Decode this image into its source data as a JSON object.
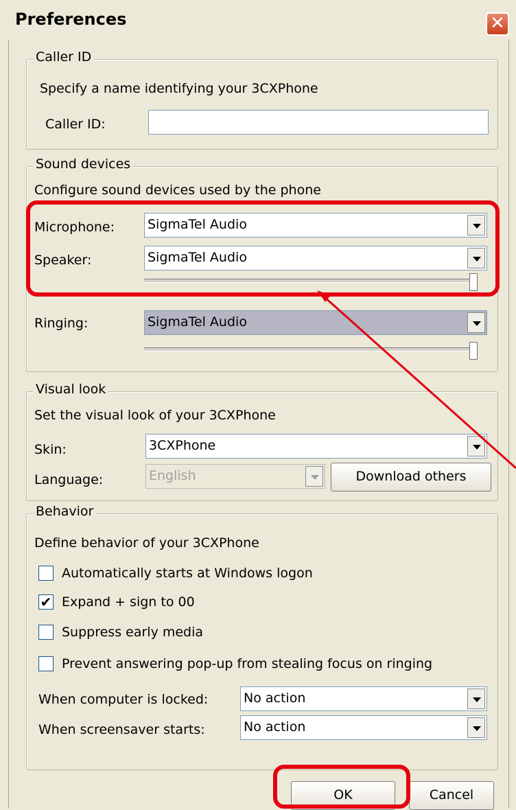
{
  "window": {
    "title": "Preferences",
    "close_symbol": "✕"
  },
  "caller_id": {
    "legend": "Caller ID",
    "description": "Specify a name identifying your 3CXPhone",
    "label": "Caller ID:",
    "value": ""
  },
  "sound": {
    "legend": "Sound devices",
    "description": "Configure sound devices used by the phone",
    "microphone_label": "Microphone:",
    "microphone_value": "SigmaTel Audio",
    "speaker_label": "Speaker:",
    "speaker_value": "SigmaTel Audio",
    "speaker_volume": 1.0,
    "ringing_label": "Ringing:",
    "ringing_value": "SigmaTel Audio",
    "ringing_volume": 1.0
  },
  "visual": {
    "legend": "Visual look",
    "description": "Set the visual look of your 3CXPhone",
    "skin_label": "Skin:",
    "skin_value": "3CXPhone",
    "language_label": "Language:",
    "language_value": "English",
    "download_label": "Download others"
  },
  "behavior": {
    "legend": "Behavior",
    "description": "Define behavior of your 3CXPhone",
    "options": [
      {
        "label": "Automatically starts at Windows logon",
        "checked": false
      },
      {
        "label": "Expand + sign to 00",
        "checked": true
      },
      {
        "label": "Suppress early media",
        "checked": false
      },
      {
        "label": "Prevent answering pop-up from stealing focus on ringing",
        "checked": false
      }
    ],
    "locked_label": "When computer is locked:",
    "locked_value": "No action",
    "screensaver_label": "When screensaver starts:",
    "screensaver_value": "No action"
  },
  "buttons": {
    "ok": "OK",
    "cancel": "Cancel"
  },
  "annotation_color": "#e4000f"
}
